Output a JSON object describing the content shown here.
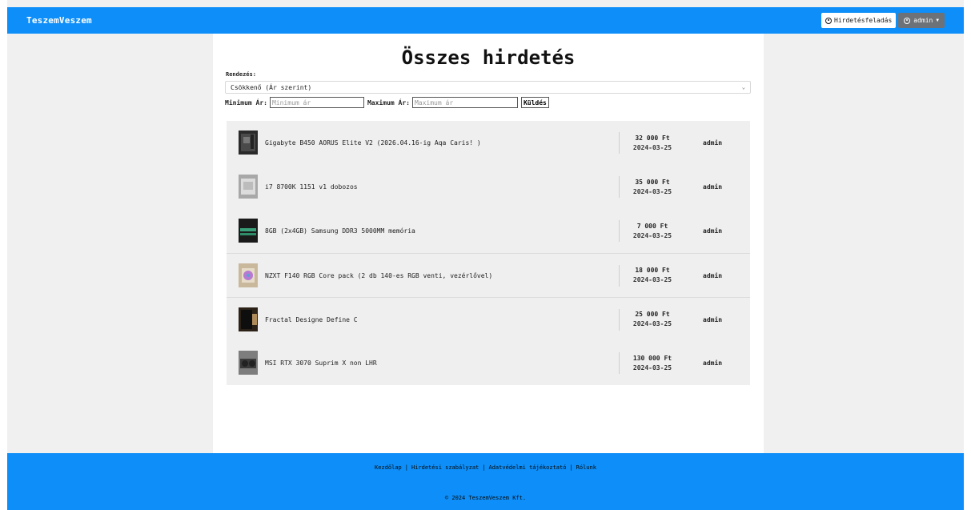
{
  "navbar": {
    "brand": "TeszemVeszem",
    "post_button": "Hirdetésfeladás",
    "user_button": "admin",
    "colors": {
      "bar": "#0d8ef8",
      "user_button": "#6d7278"
    },
    "icons": {
      "post": "plus-circle-icon",
      "user": "user-circle-icon",
      "caret": "caret-down-icon"
    }
  },
  "page": {
    "title": "Összes hirdetés",
    "sort_label": "Rendezés:",
    "sort_value": "Csökkenő (Ár szerint)",
    "filter": {
      "min_label": "Minimum Ár:",
      "min_placeholder": "Minimum ár",
      "max_label": "Maximum Ár:",
      "max_placeholder": "Maximum ár",
      "submit_label": "Küldés"
    }
  },
  "listings": [
    {
      "title": "Gigabyte B450 AORUS Elite V2 (2026.04.16-ig Aqa Caris! )",
      "price": "32 000 Ft",
      "date": "2024-03-25",
      "user": "admin",
      "thumb": "motherboard-thumbnail"
    },
    {
      "title": "i7 8700K 1151 v1 dobozos",
      "price": "35 000 Ft",
      "date": "2024-03-25",
      "user": "admin",
      "thumb": "cpu-box-thumbnail"
    },
    {
      "title": "8GB (2x4GB) Samsung DDR3 5000MM memória",
      "price": "7 000 Ft",
      "date": "2024-03-25",
      "user": "admin",
      "thumb": "ram-thumbnail"
    },
    {
      "title": "NZXT F140 RGB Core pack (2 db 140-es RGB venti, vezérlővel)",
      "price": "18 000 Ft",
      "date": "2024-03-25",
      "user": "admin",
      "thumb": "fan-pack-thumbnail"
    },
    {
      "title": "Fractal Designe Define C",
      "price": "25 000 Ft",
      "date": "2024-03-25",
      "user": "admin",
      "thumb": "pc-case-thumbnail"
    },
    {
      "title": "MSI RTX 3070 Suprim X non LHR",
      "price": "130 000 Ft",
      "date": "2024-03-25",
      "user": "admin",
      "thumb": "gpu-thumbnail"
    }
  ],
  "footer": {
    "links": [
      "Kezdőlap",
      "Hirdetési szabályzat",
      "Adatvédelmi tájékoztató",
      "Rólunk"
    ],
    "copyright": "© 2024 TeszemVeszem Kft."
  }
}
